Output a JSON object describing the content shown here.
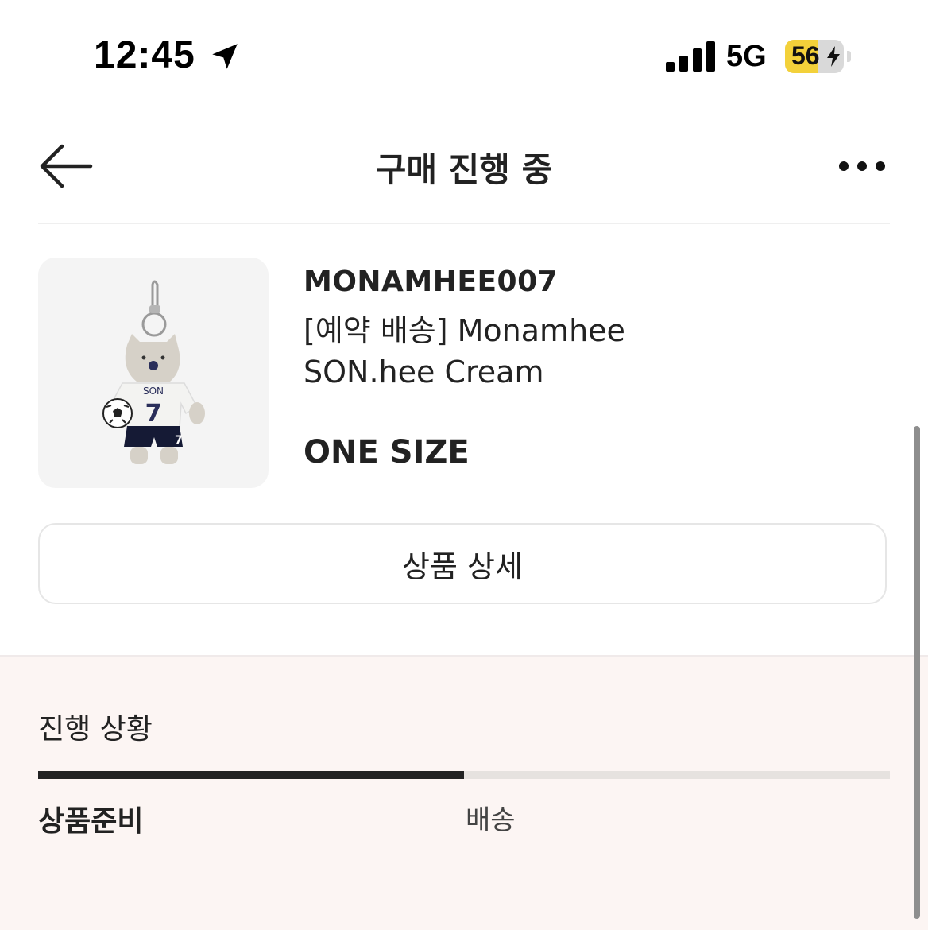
{
  "status_bar": {
    "time": "12:45",
    "location_icon": "location-arrow-icon",
    "signal_icon": "cellular-signal-icon",
    "network": "5G",
    "battery_level": "56",
    "battery_percent": 56,
    "charging_icon": "bolt-icon",
    "battery_color": "#f3d13a"
  },
  "header": {
    "back_icon": "arrow-left-icon",
    "title": "구매 진행 중",
    "more_icon": "more-horizontal-icon"
  },
  "product": {
    "image_icon": "plush-keychain-image",
    "brand": "MONAMHEE007",
    "name_line1": "[예약 배송] Monamhee",
    "name_line2": "SON.hee Cream",
    "size": "ONE SIZE",
    "detail_button": "상품 상세"
  },
  "progress": {
    "title": "진행 상황",
    "steps": [
      "상품준비",
      "배송"
    ],
    "current_step": 1,
    "total_steps": 2,
    "fraction_complete": 0.5,
    "active_color": "#222222",
    "background_color": "#fcf5f3"
  }
}
